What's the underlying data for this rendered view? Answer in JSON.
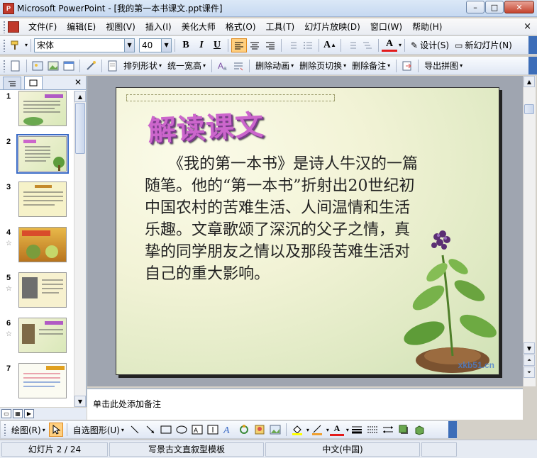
{
  "window": {
    "app_name": "Microsoft PowerPoint",
    "title": "Microsoft PowerPoint - [我的第一本书课文.ppt课件]",
    "app_icon_letter": "P",
    "minimize_glyph": "–",
    "maximize_glyph": "□",
    "close_glyph": "✕"
  },
  "menu": {
    "items": [
      "文件(F)",
      "编辑(E)",
      "视图(V)",
      "插入(I)",
      "美化大师",
      "格式(O)",
      "工具(T)",
      "幻灯片放映(D)",
      "窗口(W)",
      "帮助(H)"
    ],
    "close_glyph": "×"
  },
  "format_toolbar": {
    "font": "宋体",
    "font_size": "40",
    "bold": "B",
    "italic": "I",
    "underline": "U",
    "font_color_letter": "A",
    "design_label": "设计(S)",
    "new_slide_label": "新幻灯片(N)"
  },
  "drawing_tools_toolbar": {
    "arrange_label": "排列形状",
    "unify_width_label": "统一宽高",
    "delete_animation_label": "删除动画",
    "delete_transition_label": "删除页切换",
    "delete_notes_label": "删除备注",
    "export_label": "导出拼图"
  },
  "outline_panel": {
    "slides": [
      {
        "number": "1",
        "has_star": false
      },
      {
        "number": "2",
        "has_star": false
      },
      {
        "number": "3",
        "has_star": false
      },
      {
        "number": "4",
        "has_star": true
      },
      {
        "number": "5",
        "has_star": true
      },
      {
        "number": "6",
        "has_star": true
      },
      {
        "number": "7",
        "has_star": false
      }
    ],
    "selected_slide": "2",
    "star_glyph": "☆"
  },
  "slide": {
    "title": "解读课文",
    "body": "《我的第一本书》是诗人牛汉的一篇随笔。他的“第一本书”折射出20世纪初中国农村的苦难生活、人间温情和生活乐趣。文章歌颂了深沉的父子之情，真挚的同学朋友之情以及那段苦难生活对自己的重大影响。",
    "watermark": "xkb51.cn",
    "title_color": "#cc66cc"
  },
  "notes": {
    "placeholder": "单击此处添加备注"
  },
  "draw_toolbar": {
    "draw_label": "绘图(R)",
    "autoshapes_label": "自选图形(U)"
  },
  "status": {
    "slide_info": "幻灯片 2 / 24",
    "template": "写景古文直叙型模板",
    "language": "中文(中国)"
  }
}
